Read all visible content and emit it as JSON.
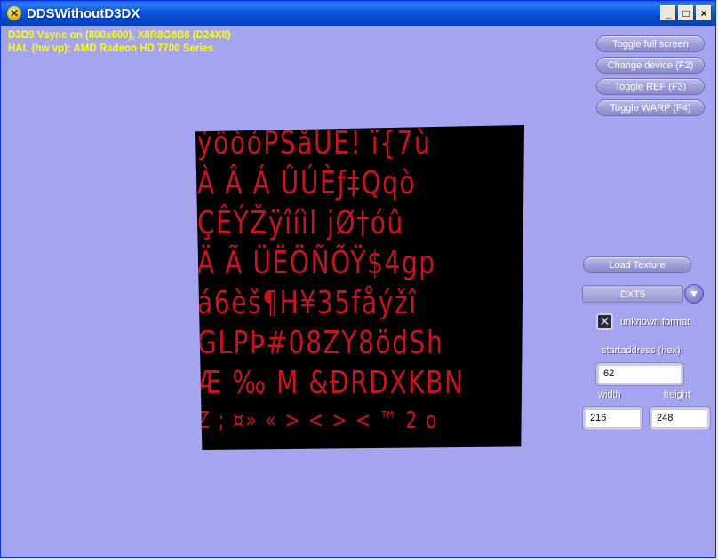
{
  "window": {
    "title": "DDSWithoutD3DX",
    "controls": {
      "minimize": "_",
      "maximize": "□",
      "close": "×"
    }
  },
  "stats": {
    "line1": "D3D9 Vsync on (800x600), X8R8G8B8 (D24X8)",
    "line2": "HAL (hw vp): AMD Radeon HD 7700 Series"
  },
  "buttons": {
    "toggle_full_screen": "Toggle full screen",
    "change_device": "Change device (F2)",
    "toggle_ref": "Toggle REF (F3)",
    "toggle_warp": "Toggle WARP (F4)",
    "load_texture": "Load Texture"
  },
  "texture_rows": [
    "ýôòóPŠåÙÉ! ï{7ù",
    "À Â Á ÛÚÈƒ‡Qqò",
    "ÇÊÝŽÿîíìl jØ†óû",
    "Ä Ã ÜËÖÑÕŸ$4gp",
    "á6èš¶H¥35fåýžî",
    "GLPÞ#08ZY8ödSh",
    "Æ ‰ M &ÐRDXKBN",
    "Z ; ¤» « > < > < ™ 2 o"
  ],
  "format": {
    "selected": "DXT5",
    "unknown_format_label": "unknown format",
    "unknown_format_checked": true
  },
  "fields": {
    "start_address_label": "startaddress (hex):",
    "start_address_value": "62",
    "width_label": "width",
    "width_value": "216",
    "height_label": "height",
    "height_value": "248"
  },
  "colors": {
    "background": "#a4a4f0",
    "stats_text": "#ffff00",
    "texture_glyphs": "#c8141e",
    "titlebar": "#0855dd"
  }
}
